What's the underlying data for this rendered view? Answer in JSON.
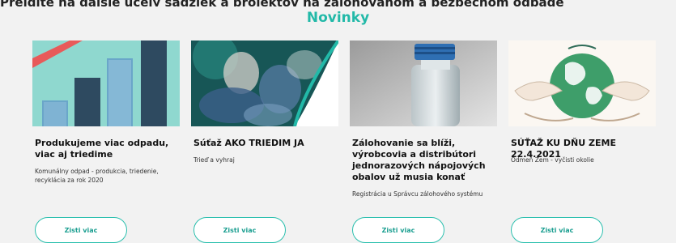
{
  "header": {
    "cut_text": "Prejdite na ďalšie účely sadziek a projektov na zalohovanom a bezpečnom odpade",
    "section_title": "Novinky"
  },
  "cards": [
    {
      "title": "Produkujeme viac odpadu, viac aj triedime",
      "subtitle": "Komunálny odpad - produkcia, triedenie, recyklácia za rok 2020",
      "button": "Zisti viac",
      "image_icon": "bar-chart-illustration"
    },
    {
      "title": "Súťaž AKO TRIEDIM JA",
      "subtitle": "Trieď a vyhraj",
      "button": "Zisti viac",
      "image_icon": "photo-people-sorting"
    },
    {
      "title": "Zálohovanie sa blíži, výrobcovia a distribútori jednorazových nápojových obalov už musia konať",
      "subtitle": "Registrácia u Správcu zálohového systému",
      "button": "Zisti viac",
      "image_icon": "photo-plastic-bottle"
    },
    {
      "title": "SÚŤAŽ KU DŇU ZEME 22.4.2021",
      "subtitle": "Odmeň Zem - vyčisti okolie",
      "button": "Zisti viac",
      "image_icon": "earth-hands-illustration"
    }
  ],
  "colors": {
    "accent": "#22b9a8",
    "chart_bg": "#8fd8cf",
    "chart_bar_light": "#6aa6c9",
    "chart_bar_dark": "#2e4a60",
    "chart_stripe": "#e85a5a",
    "earth_green": "#3e9e6a"
  }
}
